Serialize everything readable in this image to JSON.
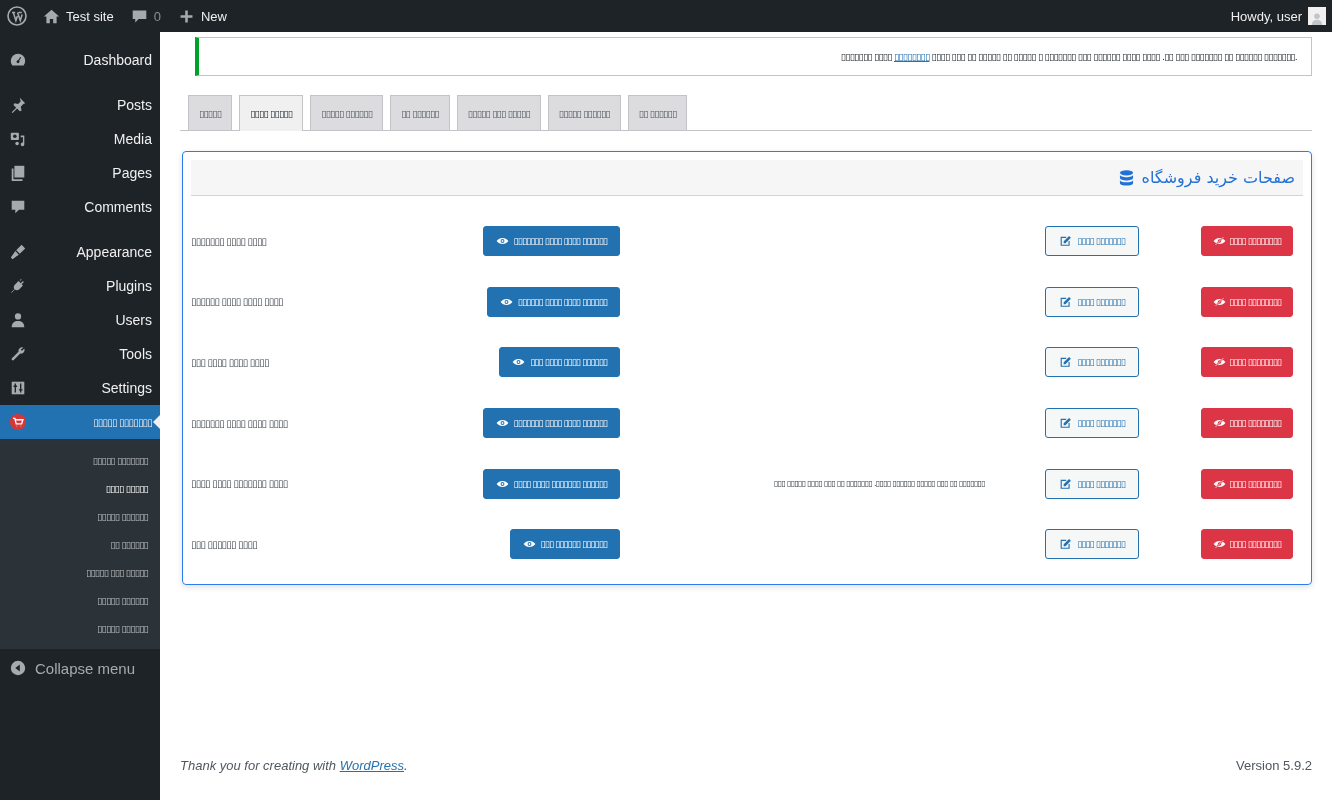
{
  "admin_bar": {
    "site": "Test site",
    "comments": "0",
    "new": "New",
    "greeting": "Howdy, user"
  },
  "sidebar": {
    "items": [
      {
        "label": "Dashboard",
        "selected": false
      },
      {
        "label": "Posts",
        "selected": false
      },
      {
        "label": "Media",
        "selected": false
      },
      {
        "label": "Pages",
        "selected": false
      },
      {
        "label": "Comments",
        "selected": false
      },
      {
        "label": "Appearance",
        "selected": false
      },
      {
        "label": "Plugins",
        "selected": false
      },
      {
        "label": "Users",
        "selected": false
      },
      {
        "label": "Tools",
        "selected": false
      },
      {
        "label": "Settings",
        "selected": false
      },
      {
        "label": "▯▯▯▯▯ ▯▯▯▯▯▯▯",
        "selected": true
      }
    ],
    "submenu": [
      {
        "label": "▯▯▯▯▯ ▯▯▯▯▯▯▯",
        "selected": false
      },
      {
        "label": "▯▯▯▯ ▯▯▯▯▯",
        "selected": true
      },
      {
        "label": "▯▯▯▯▯ ▯▯▯▯▯▯",
        "selected": false
      },
      {
        "label": "▯▯ ▯▯▯▯▯▯",
        "selected": false
      },
      {
        "label": "▯▯▯▯▯ ▯▯▯ ▯▯▯▯▯",
        "selected": false
      },
      {
        "label": "▯▯▯▯▯ ▯▯▯▯▯▯",
        "selected": false
      },
      {
        "label": "▯▯▯▯▯ ▯▯▯▯▯▯",
        "selected": false
      }
    ],
    "collapse": "Collapse menu"
  },
  "notice": {
    "before": "▯▯▯▯▯▯▯ ▯▯▯▯",
    "link": "▯▯▯▯▯▯▯▯",
    "after": "▯▯▯▯ ▯▯▯ ▯▯ ▯▯▯▯▯ ▯▯ ▯▯▯▯▯ ▯ ▯▯▯▯▯▯▯ ▯▯▯ ▯▯▯▯▯▯ ▯▯▯▯ ▯▯▯▯ .▯▯ ▯▯▯ ▯▯▯▯▯▯▯ ▯▯ ▯▯▯▯▯▯ ▯▯▯▯▯▯▯."
  },
  "tabs": [
    {
      "label": "▯▯▯▯▯",
      "selected": false
    },
    {
      "label": "▯▯▯▯ ▯▯▯▯▯",
      "selected": true
    },
    {
      "label": "▯▯▯▯▯ ▯▯▯▯▯▯",
      "selected": false
    },
    {
      "label": "▯▯ ▯▯▯▯▯▯",
      "selected": false
    },
    {
      "label": "▯▯▯▯▯ ▯▯▯ ▯▯▯▯▯",
      "selected": false
    },
    {
      "label": "▯▯▯▯▯ ▯▯▯▯▯▯",
      "selected": false
    },
    {
      "label": "▯▯ ▯▯▯▯▯▯",
      "selected": false
    }
  ],
  "panel": {
    "title": "صفحات خرید فروشگاه",
    "rows": [
      {
        "label": "▯▯▯▯▯▯▯ ▯▯▯▯ ▯▯▯▯",
        "view": "▯▯▯▯▯▯▯ ▯▯▯▯ ▯▯▯▯ ▯▯▯▯▯▯",
        "edit": "▯▯▯▯ ▯▯▯▯▯▯▯",
        "delete": "▯▯▯▯ ▯▯▯▯▯▯▯▯"
      },
      {
        "label": "▯▯▯▯▯▯ ▯▯▯▯ ▯▯▯▯ ▯▯▯▯",
        "view": "▯▯▯▯▯▯ ▯▯▯▯ ▯▯▯▯ ▯▯▯▯▯▯",
        "edit": "▯▯▯▯ ▯▯▯▯▯▯▯",
        "delete": "▯▯▯▯ ▯▯▯▯▯▯▯▯"
      },
      {
        "label": "▯▯▯ ▯▯▯▯ ▯▯▯▯ ▯▯▯▯",
        "view": "▯▯▯ ▯▯▯▯ ▯▯▯▯ ▯▯▯▯▯▯",
        "edit": "▯▯▯▯ ▯▯▯▯▯▯▯",
        "delete": "▯▯▯▯ ▯▯▯▯▯▯▯▯"
      },
      {
        "label": "▯▯▯▯▯▯▯ ▯▯▯▯ ▯▯▯▯ ▯▯▯▯",
        "view": "▯▯▯▯▯▯▯ ▯▯▯▯ ▯▯▯▯ ▯▯▯▯▯▯",
        "edit": "▯▯▯▯ ▯▯▯▯▯▯▯",
        "delete": "▯▯▯▯ ▯▯▯▯▯▯▯▯"
      },
      {
        "label": "▯▯▯▯ ▯▯▯▯ ▯▯▯▯▯▯▯ ▯▯▯▯",
        "view": "▯▯▯▯ ▯▯▯▯ ▯▯▯▯▯▯▯ ▯▯▯▯▯▯",
        "note": "▯▯▯ ▯▯▯▯▯ ▯▯▯▯ ▯▯▯ ▯▯ ▯▯▯▯▯▯▯ .▯▯▯▯ ▯▯▯▯▯▯ ▯▯▯▯▯ ▯▯▯ ▯▯ ▯▯▯▯▯▯▯",
        "edit": "▯▯▯▯ ▯▯▯▯▯▯▯",
        "delete": "▯▯▯▯ ▯▯▯▯▯▯▯▯"
      },
      {
        "label": "▯▯▯ ▯▯▯▯▯▯ ▯▯▯▯",
        "view": "▯▯▯ ▯▯▯▯▯▯ ▯▯▯▯▯▯",
        "edit": "▯▯▯▯ ▯▯▯▯▯▯▯",
        "delete": "▯▯▯▯ ▯▯▯▯▯▯▯▯"
      }
    ]
  },
  "footer": {
    "text": "Thank you for creating with",
    "link": "WordPress",
    "period": ".",
    "version": "Version 5.9.2"
  }
}
